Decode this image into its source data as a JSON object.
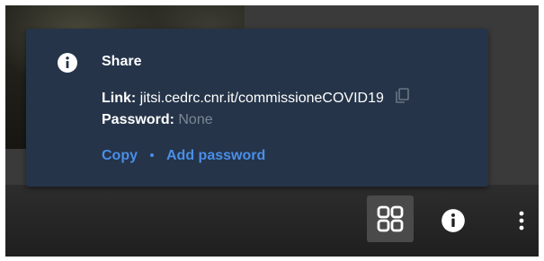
{
  "share_popover": {
    "title": "Share",
    "link_label": "Link:",
    "link_value": "jitsi.cedrc.cnr.it/commissioneCOVID19",
    "password_label": "Password:",
    "password_value": "None",
    "copy_action": "Copy",
    "add_password_action": "Add password",
    "icon": "info-icon",
    "copy_icon": "copy-icon"
  },
  "toolbar": {
    "tile_view_icon": "tile-view-icon",
    "info_icon": "info-icon",
    "more_icon": "more-vertical-icon"
  },
  "colors": {
    "popover_bg": "#253449",
    "link_blue": "#4a8ee8",
    "muted_text": "#7d8896",
    "stage_bg": "#3a3a3a",
    "tile_button_bg": "#4a4a4a"
  }
}
